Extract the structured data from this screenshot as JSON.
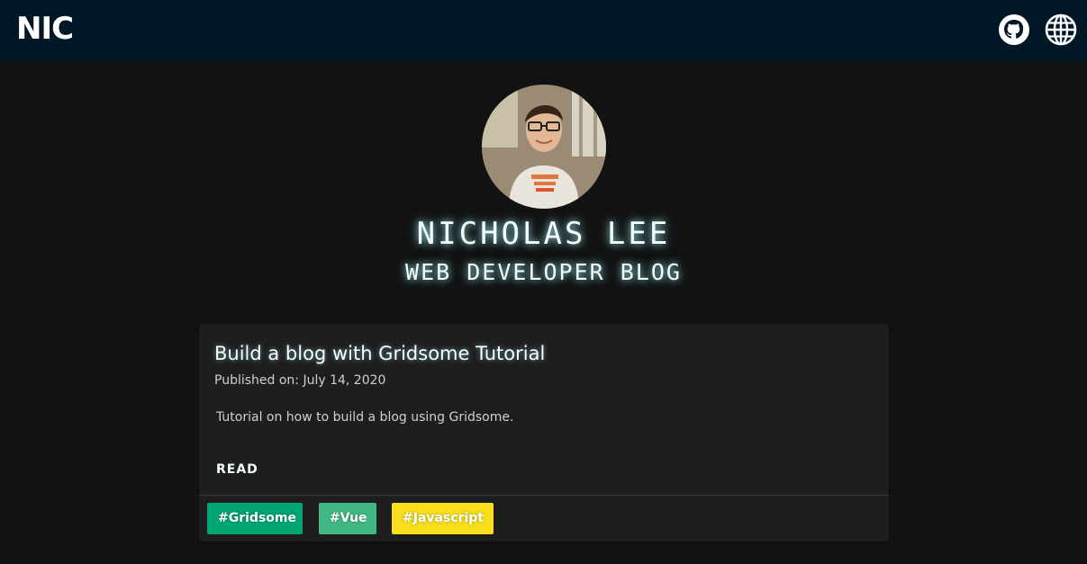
{
  "header": {
    "logo": "NIC",
    "background": "#001826",
    "icons": [
      {
        "name": "github-icon",
        "label": "GitHub"
      },
      {
        "name": "globe-icon",
        "label": "Website"
      }
    ]
  },
  "profile": {
    "avatar": "avatar-photo",
    "name": "NICHOLAS LEE",
    "tagline": "WEB DEVELOPER BLOG"
  },
  "posts": [
    {
      "title": "Build a blog with Gridsome Tutorial",
      "date": "Published on: July 14, 2020",
      "description": "Tutorial on how to build a blog using Gridsome.",
      "read_label": "READ",
      "tags": [
        {
          "label": "#Gridsome",
          "color": "#00a672"
        },
        {
          "label": "#Vue",
          "color": "#41b883"
        },
        {
          "label": "#Javascript",
          "color": "#f7df1e"
        }
      ]
    }
  ],
  "colors": {
    "page_background": "#121212",
    "card_background": "#1e1e1e",
    "glow_text": "#f4ffff"
  }
}
